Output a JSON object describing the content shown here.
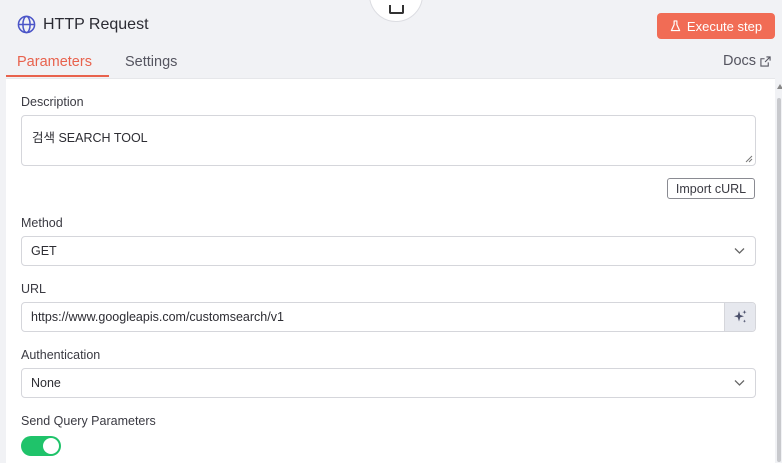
{
  "header": {
    "title": "HTTP Request",
    "execute_label": "Execute step",
    "icons": {
      "node": "globe-icon",
      "execute": "flask-icon"
    }
  },
  "tabs": [
    {
      "label": "Parameters",
      "active": true
    },
    {
      "label": "Settings",
      "active": false
    }
  ],
  "docs_label": "Docs",
  "fields": {
    "description": {
      "label": "Description",
      "value": "검색 SEARCH TOOL"
    },
    "import_label": "Import cURL",
    "method": {
      "label": "Method",
      "value": "GET"
    },
    "url": {
      "label": "URL",
      "value": "https://www.googleapis.com/customsearch/v1"
    },
    "authentication": {
      "label": "Authentication",
      "value": "None"
    },
    "send_query": {
      "label": "Send Query Parameters",
      "enabled": true
    }
  },
  "colors": {
    "accent": "#f16c55",
    "toggle_on": "#1fc36a"
  }
}
